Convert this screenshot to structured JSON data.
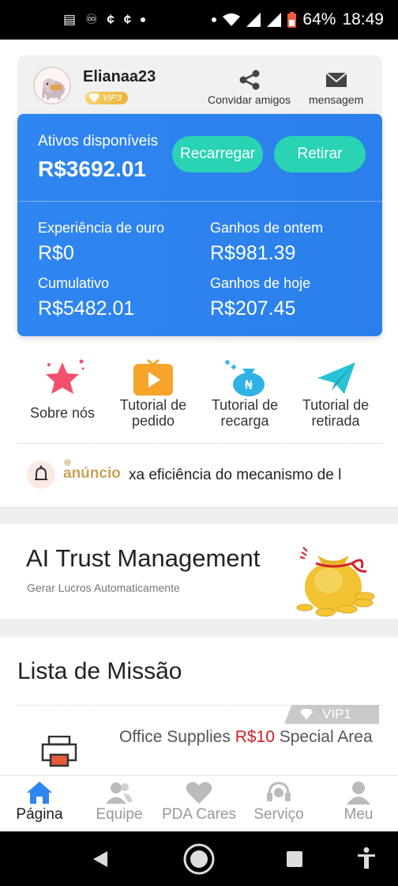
{
  "status_bar": {
    "battery": "64%",
    "time": "18:49"
  },
  "user": {
    "name": "Elianaa23",
    "vip": "VIP3"
  },
  "top_actions": {
    "invite": "Convidar amigos",
    "message": "mensagem"
  },
  "balance": {
    "label": "Ativos disponíveis",
    "value": "R$3692.01",
    "recharge_btn": "Recarregar",
    "withdraw_btn": "Retirar"
  },
  "stats": [
    {
      "label": "Experiência de ouro",
      "value": "R$0"
    },
    {
      "label": "Ganhos de ontem",
      "value": "R$981.39"
    },
    {
      "label": "Cumulativo",
      "value": "R$5482.01"
    },
    {
      "label": "Ganhos de hoje",
      "value": "R$207.45"
    }
  ],
  "quick_links": [
    {
      "label": "Sobre nós",
      "icon": "star-icon"
    },
    {
      "label": "Tutorial de pedido",
      "icon": "video-icon"
    },
    {
      "label": "Tutorial de recarga",
      "icon": "money-bag-icon"
    },
    {
      "label": "Tutorial de retirada",
      "icon": "paper-plane-icon"
    }
  ],
  "announcement": {
    "label": "anúncio",
    "text": "xa eficiência do mecanismo de l"
  },
  "ai_trust": {
    "title": "AI Trust Management",
    "subtitle": "Gerar Lucros Automaticamente"
  },
  "mission": {
    "title": "Lista de Missão",
    "vip_tag": "VIP1",
    "item_name": "Office Supplies",
    "item_price": "R$10",
    "item_area": "Special Area"
  },
  "tabs": [
    {
      "label": "Página",
      "icon": "home-icon",
      "active": true
    },
    {
      "label": "Equipe",
      "icon": "team-icon"
    },
    {
      "label": "PDA Cares",
      "icon": "heart-icon"
    },
    {
      "label": "Serviço",
      "icon": "headset-icon"
    },
    {
      "label": "Meu",
      "icon": "user-icon"
    }
  ],
  "colors": {
    "card_blue": "#2f86f0",
    "button_teal": "#29d3b4",
    "price_red": "#d0202a",
    "announcement_gold": "#c9a35a"
  }
}
